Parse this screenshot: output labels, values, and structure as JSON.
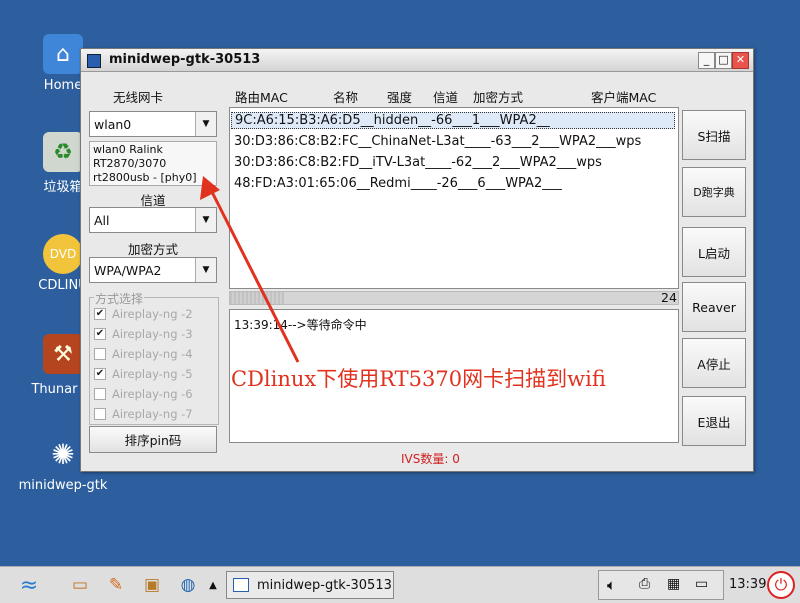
{
  "desktop": {
    "icons": [
      {
        "label": "Home",
        "icon": "home-folder-icon"
      },
      {
        "label": "垃圾箱",
        "icon": "trash-icon"
      },
      {
        "label": "CDLINU",
        "icon": "dvd-icon"
      },
      {
        "label": "Thunar 文",
        "icon": "file-manager-icon"
      },
      {
        "label": "minidwep-gtk",
        "icon": "minidwep-gtk-icon"
      }
    ]
  },
  "window": {
    "title": "minidwep-gtk-30513",
    "controls": {
      "minimize": "_",
      "maximize": "□",
      "close": "✕"
    }
  },
  "left_panel": {
    "nic_label": "无线网卡",
    "nic_value": "wlan0",
    "nic_info": [
      "wlan0 Ralink",
      "RT2870/3070",
      "rt2800usb - [phy0]"
    ],
    "channel_label": "信道",
    "channel_value": "All",
    "encryption_label": "加密方式",
    "encryption_value": "WPA/WPA2",
    "method_label": "方式选择",
    "methods": [
      {
        "label": "Aireplay-ng -2",
        "checked": true
      },
      {
        "label": "Aireplay-ng -3",
        "checked": true
      },
      {
        "label": "Aireplay-ng -4",
        "checked": false
      },
      {
        "label": "Aireplay-ng -5",
        "checked": true
      },
      {
        "label": "Aireplay-ng -6",
        "checked": false
      },
      {
        "label": "Aireplay-ng -7",
        "checked": false
      }
    ],
    "sort_button": "排序pin码"
  },
  "ap_table": {
    "headers": [
      "路由MAC",
      "名称",
      "强度",
      "信道",
      "加密方式",
      "客户端MAC"
    ],
    "rows": [
      "9C:A6:15:B3:A6:D5__hidden__-66___1___WPA2__",
      "30:D3:86:C8:B2:FC__ChinaNet-L3at____-63___2___WPA2___wps",
      "30:D3:86:C8:B2:FD__iTV-L3at____-62___2___WPA2___wps",
      "48:FD:A3:01:65:06__Redmi____-26___6___WPA2___"
    ],
    "selected_index": 0
  },
  "progress": {
    "value_text": "24",
    "fraction": 0.12
  },
  "log": {
    "lines": [
      "13:39:14-->等待命令中"
    ]
  },
  "right_buttons": [
    "S扫描",
    "D跑字典",
    "L启动",
    "Reaver",
    "A停止",
    "E退出"
  ],
  "status": {
    "ivs": "IVS数量: 0"
  },
  "annotation": {
    "text": "CDlinux下使用RT5370网卡扫描到wifi",
    "color": "#e0321e"
  },
  "taskbar": {
    "launchers": [
      "start-icon",
      "table-icon",
      "text-editor-icon",
      "image-viewer-icon",
      "browser-globe-icon",
      "up-arrow-icon"
    ],
    "task_label": "minidwep-gtk-30513",
    "clock": "13:39"
  }
}
